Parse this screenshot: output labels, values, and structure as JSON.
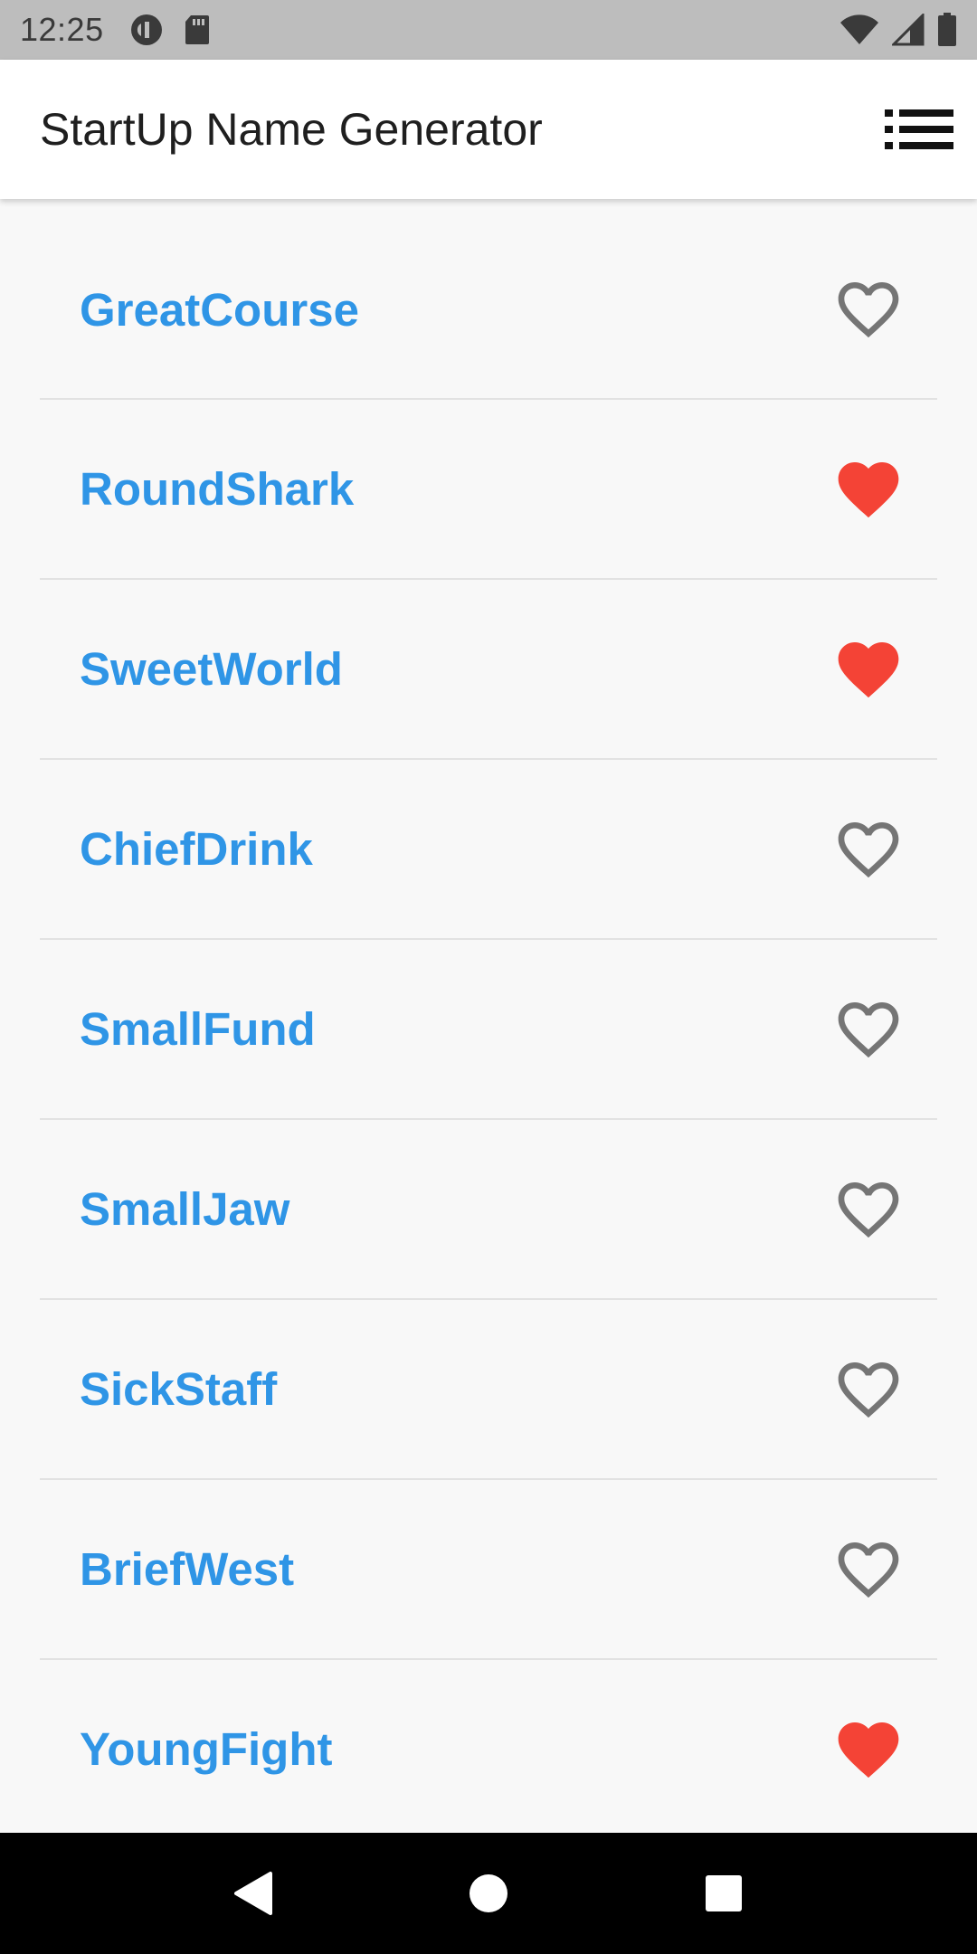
{
  "status_bar": {
    "time": "12:25",
    "left_icons": [
      "circle-app-icon",
      "sd-card-icon"
    ],
    "right_icons": [
      "wifi-icon",
      "signal-icon",
      "battery-icon"
    ]
  },
  "app_bar": {
    "title": "StartUp Name Generator",
    "action_icon": "saved-list-icon"
  },
  "colors": {
    "name_text": "#2f95e6",
    "heart_filled": "#f44336",
    "heart_outline": "#757575"
  },
  "list": {
    "items": [
      {
        "name": "GreatCourse",
        "favorited": false
      },
      {
        "name": "RoundShark",
        "favorited": true
      },
      {
        "name": "SweetWorld",
        "favorited": true
      },
      {
        "name": "ChiefDrink",
        "favorited": false
      },
      {
        "name": "SmallFund",
        "favorited": false
      },
      {
        "name": "SmallJaw",
        "favorited": false
      },
      {
        "name": "SickStaff",
        "favorited": false
      },
      {
        "name": "BriefWest",
        "favorited": false
      },
      {
        "name": "YoungFight",
        "favorited": true
      }
    ]
  },
  "nav_bar": {
    "buttons": [
      "back-icon",
      "home-icon",
      "recents-icon"
    ]
  }
}
